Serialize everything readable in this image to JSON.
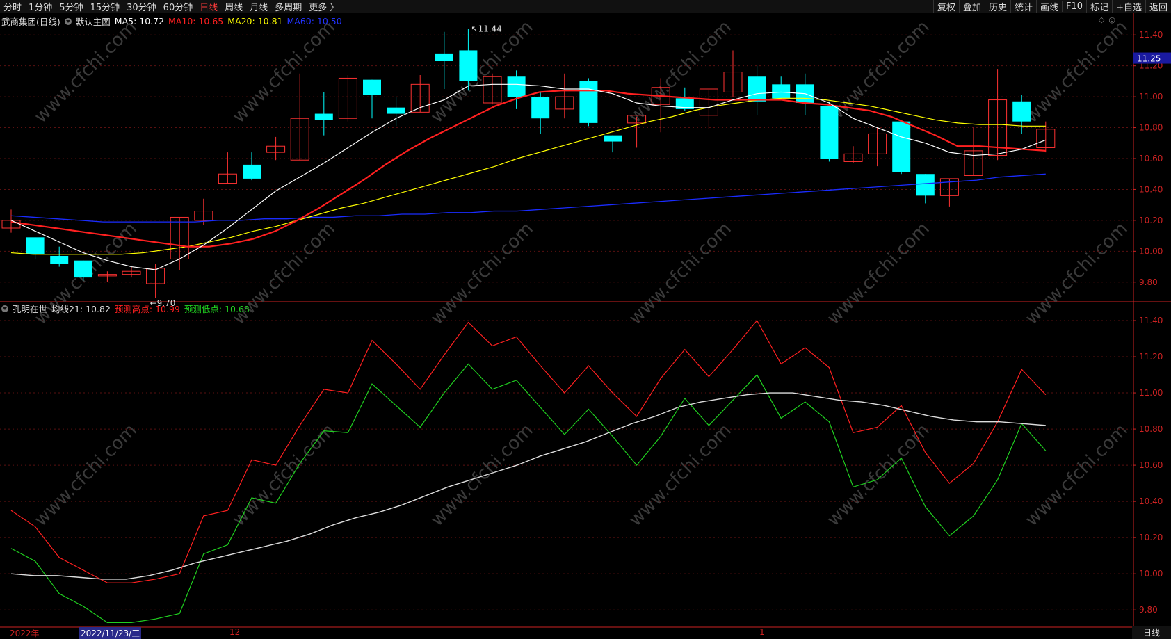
{
  "topbar": {
    "tabs": [
      {
        "label": "分时",
        "active": false
      },
      {
        "label": "1分钟",
        "active": false
      },
      {
        "label": "5分钟",
        "active": false
      },
      {
        "label": "15分钟",
        "active": false
      },
      {
        "label": "30分钟",
        "active": false
      },
      {
        "label": "60分钟",
        "active": false
      },
      {
        "label": "日线",
        "active": true
      },
      {
        "label": "周线",
        "active": false
      },
      {
        "label": "月线",
        "active": false
      },
      {
        "label": "多周期",
        "active": false
      },
      {
        "label": "更多 〉",
        "active": false
      }
    ],
    "tools": [
      "复权",
      "叠加",
      "历史",
      "统计",
      "画线",
      "F10",
      "+自选",
      "返回"
    ],
    "mark_label": "标记"
  },
  "main_legend": {
    "stock": "武商集团(日线)",
    "template": "默认主图",
    "ma5": "MA5: 10.72",
    "ma10": "MA10: 10.65",
    "ma20": "MA20: 10.81",
    "ma60": "MA60: 10.50"
  },
  "sub_legend": {
    "name": "孔明在世",
    "avg": "均线21: 10.82",
    "high": "预测高点: 10.99",
    "low": "预测低点: 10.68"
  },
  "annotations": {
    "high_mark": "11.44",
    "low_mark": "9.70",
    "current_price": "11.25"
  },
  "bottom": {
    "year": "2022年",
    "date": "2022/11/23/三",
    "month12": "12",
    "month1": "1",
    "period_tab": "日线"
  },
  "watermark": "www.cfchi.com",
  "colors": {
    "up": "#ff3232",
    "down": "#00ffff",
    "ma5": "#ffffff",
    "ma10": "#ff2020",
    "ma20": "#ffff00",
    "ma60": "#1a2cff",
    "high": "#ff2020",
    "low": "#20d020",
    "avg": "#dddddd",
    "axis": "#cc2222"
  },
  "chart_data": [
    {
      "type": "candlestick",
      "title": "武商集团(日线)",
      "ylim": [
        9.7,
        11.5
      ],
      "y_ticks": [
        "11.40",
        "11.20",
        "11.00",
        "10.80",
        "10.60",
        "10.40",
        "10.20",
        "10.00",
        "9.80"
      ],
      "candles": [
        {
          "o": 10.15,
          "h": 10.27,
          "c": 10.2,
          "l": 10.12
        },
        {
          "o": 10.09,
          "h": 10.09,
          "c": 9.98,
          "l": 9.95
        },
        {
          "o": 9.97,
          "h": 10.03,
          "c": 9.92,
          "l": 9.9
        },
        {
          "o": 9.94,
          "h": 9.94,
          "c": 9.83,
          "l": 9.81
        },
        {
          "o": 9.84,
          "h": 9.87,
          "c": 9.85,
          "l": 9.8
        },
        {
          "o": 9.85,
          "h": 9.9,
          "c": 9.87,
          "l": 9.83
        },
        {
          "o": 9.79,
          "h": 9.92,
          "c": 9.89,
          "l": 9.7
        },
        {
          "o": 9.95,
          "h": 10.22,
          "c": 10.22,
          "l": 9.88
        },
        {
          "o": 10.2,
          "h": 10.34,
          "c": 10.26,
          "l": 10.17
        },
        {
          "o": 10.44,
          "h": 10.64,
          "c": 10.5,
          "l": 10.44
        },
        {
          "o": 10.56,
          "h": 10.64,
          "c": 10.47,
          "l": 10.46
        },
        {
          "o": 10.64,
          "h": 10.74,
          "c": 10.68,
          "l": 10.59
        },
        {
          "o": 10.59,
          "h": 11.15,
          "c": 10.86,
          "l": 10.59
        },
        {
          "o": 10.89,
          "h": 11.03,
          "c": 10.85,
          "l": 10.75
        },
        {
          "o": 10.86,
          "h": 11.14,
          "c": 11.12,
          "l": 10.84
        },
        {
          "o": 11.11,
          "h": 11.11,
          "c": 11.01,
          "l": 10.86
        },
        {
          "o": 10.93,
          "h": 11.0,
          "c": 10.89,
          "l": 10.81
        },
        {
          "o": 10.9,
          "h": 11.14,
          "c": 11.08,
          "l": 10.9
        },
        {
          "o": 11.28,
          "h": 11.42,
          "c": 11.23,
          "l": 11.05
        },
        {
          "o": 11.3,
          "h": 11.44,
          "c": 11.1,
          "l": 11.04
        },
        {
          "o": 10.96,
          "h": 11.15,
          "c": 11.13,
          "l": 10.95
        },
        {
          "o": 11.13,
          "h": 11.17,
          "c": 11.0,
          "l": 10.92
        },
        {
          "o": 11.0,
          "h": 11.03,
          "c": 10.86,
          "l": 10.76
        },
        {
          "o": 10.92,
          "h": 11.15,
          "c": 11.0,
          "l": 10.86
        },
        {
          "o": 11.1,
          "h": 11.12,
          "c": 10.83,
          "l": 10.81
        },
        {
          "o": 10.75,
          "h": 10.75,
          "c": 10.71,
          "l": 10.64
        },
        {
          "o": 10.83,
          "h": 10.87,
          "c": 10.88,
          "l": 10.67
        },
        {
          "o": 10.95,
          "h": 11.12,
          "c": 11.06,
          "l": 10.77
        },
        {
          "o": 10.99,
          "h": 11.06,
          "c": 10.92,
          "l": 10.91
        },
        {
          "o": 10.88,
          "h": 11.04,
          "c": 11.05,
          "l": 10.79
        },
        {
          "o": 11.03,
          "h": 11.3,
          "c": 11.16,
          "l": 11.0
        },
        {
          "o": 11.13,
          "h": 11.2,
          "c": 10.97,
          "l": 10.88
        },
        {
          "o": 11.08,
          "h": 11.13,
          "c": 10.99,
          "l": 10.98
        },
        {
          "o": 11.08,
          "h": 11.15,
          "c": 10.96,
          "l": 10.88
        },
        {
          "o": 10.94,
          "h": 10.97,
          "c": 10.6,
          "l": 10.58
        },
        {
          "o": 10.58,
          "h": 10.68,
          "c": 10.63,
          "l": 10.57
        },
        {
          "o": 10.63,
          "h": 10.8,
          "c": 10.76,
          "l": 10.55
        },
        {
          "o": 10.84,
          "h": 10.84,
          "c": 10.51,
          "l": 10.5
        },
        {
          "o": 10.5,
          "h": 10.5,
          "c": 10.36,
          "l": 10.31
        },
        {
          "o": 10.36,
          "h": 10.47,
          "c": 10.47,
          "l": 10.29
        },
        {
          "o": 10.49,
          "h": 10.8,
          "c": 10.65,
          "l": 10.49
        },
        {
          "o": 10.62,
          "h": 11.18,
          "c": 10.98,
          "l": 10.59
        },
        {
          "o": 10.97,
          "h": 11.01,
          "c": 10.84,
          "l": 10.76
        },
        {
          "o": 10.67,
          "h": 10.84,
          "c": 10.79,
          "l": 10.64
        }
      ],
      "ma5": [
        10.2,
        10.13,
        10.06,
        9.99,
        9.94,
        9.9,
        9.88,
        9.95,
        10.04,
        10.15,
        10.27,
        10.39,
        10.48,
        10.57,
        10.67,
        10.77,
        10.86,
        10.93,
        10.98,
        11.07,
        11.08,
        11.08,
        11.07,
        11.05,
        11.05,
        11.02,
        10.96,
        10.94,
        10.93,
        10.93,
        10.98,
        11.02,
        11.03,
        11.02,
        10.96,
        10.86,
        10.8,
        10.74,
        10.7,
        10.64,
        10.62,
        10.63,
        10.66,
        10.72
      ],
      "ma10": [
        10.19,
        10.17,
        10.15,
        10.13,
        10.11,
        10.09,
        10.07,
        10.05,
        10.03,
        10.03,
        10.05,
        10.08,
        10.13,
        10.2,
        10.28,
        10.37,
        10.46,
        10.56,
        10.65,
        10.73,
        10.8,
        10.87,
        10.94,
        10.99,
        11.03,
        11.04,
        11.04,
        11.04,
        11.02,
        11.01,
        11.0,
        10.99,
        10.98,
        10.98,
        10.98,
        10.98,
        10.96,
        10.95,
        10.93,
        10.91,
        10.87,
        10.81,
        10.75,
        10.68,
        10.68,
        10.67,
        10.66,
        10.65
      ],
      "ma20": [
        9.99,
        9.98,
        9.98,
        9.98,
        9.98,
        9.98,
        9.99,
        10.01,
        10.03,
        10.06,
        10.09,
        10.13,
        10.16,
        10.2,
        10.24,
        10.28,
        10.31,
        10.35,
        10.39,
        10.43,
        10.47,
        10.51,
        10.55,
        10.6,
        10.64,
        10.68,
        10.72,
        10.76,
        10.8,
        10.84,
        10.87,
        10.91,
        10.94,
        10.96,
        10.98,
        10.99,
        10.99,
        10.98,
        10.96,
        10.94,
        10.91,
        10.88,
        10.85,
        10.83,
        10.82,
        10.82,
        10.81,
        10.81
      ],
      "ma60": [
        10.23,
        10.22,
        10.21,
        10.2,
        10.19,
        10.19,
        10.19,
        10.19,
        10.19,
        10.2,
        10.2,
        10.21,
        10.21,
        10.22,
        10.22,
        10.23,
        10.23,
        10.24,
        10.24,
        10.25,
        10.25,
        10.26,
        10.26,
        10.27,
        10.28,
        10.29,
        10.3,
        10.31,
        10.32,
        10.33,
        10.34,
        10.35,
        10.36,
        10.37,
        10.38,
        10.39,
        10.4,
        10.41,
        10.42,
        10.43,
        10.44,
        10.45,
        10.46,
        10.48,
        10.49,
        10.5
      ]
    },
    {
      "type": "line",
      "title": "孔明在世",
      "ylim": [
        9.7,
        11.45
      ],
      "y_ticks": [
        "11.40",
        "11.20",
        "11.00",
        "10.80",
        "10.60",
        "10.40",
        "10.20",
        "10.00",
        "9.80"
      ],
      "series": [
        {
          "name": "预测高点",
          "values": [
            10.35,
            10.26,
            10.09,
            10.02,
            9.95,
            9.95,
            9.97,
            10.0,
            10.32,
            10.35,
            10.63,
            10.6,
            10.82,
            11.02,
            11.0,
            11.29,
            11.16,
            11.02,
            11.21,
            11.39,
            11.26,
            11.31,
            11.15,
            11.0,
            11.15,
            11.0,
            10.87,
            11.08,
            11.24,
            11.09,
            11.24,
            11.4,
            11.16,
            11.25,
            11.14,
            10.78,
            10.81,
            10.93,
            10.67,
            10.5,
            10.61,
            10.84,
            11.13,
            10.99
          ]
        },
        {
          "name": "预测低点",
          "values": [
            10.14,
            10.07,
            9.89,
            9.82,
            9.73,
            9.73,
            9.75,
            9.78,
            10.11,
            10.16,
            10.42,
            10.39,
            10.61,
            10.79,
            10.78,
            11.05,
            10.93,
            10.81,
            11.0,
            11.16,
            11.02,
            11.07,
            10.92,
            10.77,
            10.91,
            10.76,
            10.6,
            10.76,
            10.97,
            10.82,
            10.96,
            11.1,
            10.86,
            10.95,
            10.84,
            10.48,
            10.52,
            10.64,
            10.37,
            10.21,
            10.32,
            10.52,
            10.83,
            10.68
          ]
        },
        {
          "name": "均线21",
          "values": [
            10.0,
            9.99,
            9.99,
            9.98,
            9.97,
            9.97,
            9.99,
            10.02,
            10.06,
            10.09,
            10.12,
            10.15,
            10.18,
            10.22,
            10.27,
            10.31,
            10.34,
            10.38,
            10.43,
            10.48,
            10.52,
            10.56,
            10.6,
            10.65,
            10.69,
            10.73,
            10.78,
            10.83,
            10.87,
            10.92,
            10.95,
            10.97,
            10.99,
            11.0,
            11.0,
            10.98,
            10.96,
            10.95,
            10.93,
            10.9,
            10.87,
            10.85,
            10.84,
            10.84,
            10.83,
            10.82
          ]
        }
      ]
    }
  ]
}
